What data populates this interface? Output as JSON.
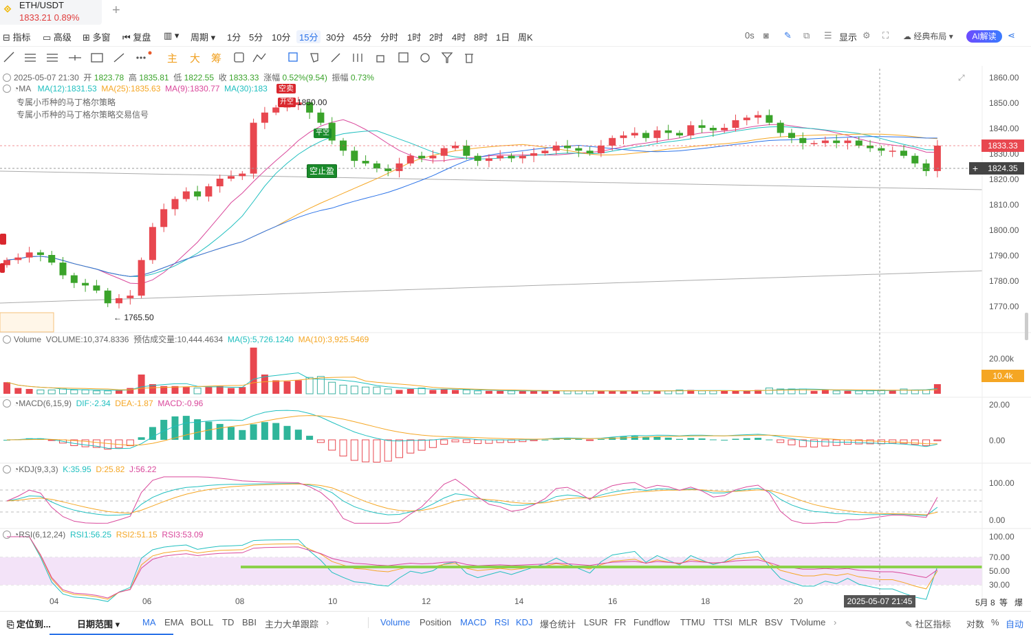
{
  "tab": {
    "symbol": "ETH/USDT",
    "price_change": "1833.21  0.89%",
    "add_label": "+"
  },
  "toolbar": {
    "indicator": "指标",
    "advanced": "高级",
    "multi_window": "多窗",
    "replay": "复盘",
    "chart_type": "",
    "period": "周期",
    "periods": [
      "1分",
      "5分",
      "10分",
      "15分",
      "30分",
      "45分",
      "分时",
      "1时",
      "2时",
      "4时",
      "8时",
      "1日",
      "周K"
    ],
    "active_period": "15分",
    "countdown": "0s",
    "display": "显示",
    "layout": "经典布局",
    "ai": "AI解读"
  },
  "drawing_tools": {
    "main": "主",
    "big": "大",
    "chip": "筹"
  },
  "ohlc": {
    "time": "2025-05-07 21:30",
    "open_label": "开",
    "open": "1823.78",
    "high_label": "高",
    "high": "1835.81",
    "low_label": "低",
    "low": "1822.55",
    "close_label": "收",
    "close": "1833.33",
    "change_label": "涨幅",
    "change": "0.52%(9.54)",
    "amp_label": "振幅",
    "amp": "0.73%"
  },
  "ma": {
    "name": "MA",
    "ma12": "MA(12):1831.53",
    "ma25": "MA(25):1835.63",
    "ma9": "MA(9):1830.77",
    "ma30": "MA(30):183",
    "strategy1": "专属小币种的马丁格尔策略",
    "strategy2": "专属小币种的马丁格尔策略交易信号"
  },
  "signals": {
    "short_buy": "空卖",
    "open_short": "开空",
    "close_short": "平空",
    "take_profit": "空止盈",
    "high_marker": "1850.00",
    "low_marker": "← 1765.50"
  },
  "price_axis": [
    "1860.00",
    "1850.00",
    "1840.00",
    "1830.00",
    "1820.00",
    "1810.00",
    "1800.00",
    "1790.00",
    "1780.00",
    "1770.00"
  ],
  "price_tags": {
    "current": "1833.33",
    "cursor": "1824.35"
  },
  "volume": {
    "name": "Volume",
    "volume": "VOLUME:10,374.8336",
    "estimated": "预估成交量:10,444.4634",
    "ma5": "MA(5):5,726.1240",
    "ma10": "MA(10):3,925.5469",
    "axis": "20.00k",
    "tag": "10.4k"
  },
  "macd": {
    "name": "MACD(6,15,9)",
    "dif": "DIF:-2.34",
    "dea": "DEA:-1.87",
    "macd": "MACD:-0.96",
    "axis_top": "20.00",
    "axis_zero": "0.00"
  },
  "kdj": {
    "name": "KDJ(9,3,3)",
    "k": "K:35.95",
    "d": "D:25.82",
    "j": "J:56.22",
    "axis_top": "100.00",
    "axis_zero": "0.00"
  },
  "rsi": {
    "name": "RSI(6,12,24)",
    "rsi1": "RSI1:56.25",
    "rsi2": "RSI2:51.15",
    "rsi3": "RSI3:53.09",
    "axis": [
      "100.00",
      "70.00",
      "50.00",
      "30.00"
    ]
  },
  "date_axis": [
    "04",
    "06",
    "08",
    "10",
    "12",
    "14",
    "16",
    "18",
    "20"
  ],
  "cursor_date": "2025-05-07 21:45",
  "date_right": "5月 8",
  "date_right2": "等",
  "date_right3": "爆",
  "bottom": {
    "locate": "定位到...",
    "date_range": "日期范围",
    "main_indicators": [
      "MA",
      "EMA",
      "BOLL",
      "TD",
      "BBI",
      "主力大单跟踪"
    ],
    "sub_indicators": [
      "Volume",
      "Position",
      "MACD",
      "RSI",
      "KDJ",
      "爆仓统计",
      "LSUR",
      "FR",
      "Fundflow",
      "TTMU",
      "TTSI",
      "MLR",
      "BSV",
      "TVolume"
    ],
    "community": "社区指标",
    "log": "对数",
    "percent": "%",
    "auto": "自动"
  },
  "colors": {
    "up": "#e8474f",
    "down": "#3aa32a",
    "ma12": "#1fbfbf",
    "ma25": "#f5a623",
    "ma9": "#d9479b",
    "ma30": "#2a72e8",
    "accent": "#2a72e8"
  }
}
